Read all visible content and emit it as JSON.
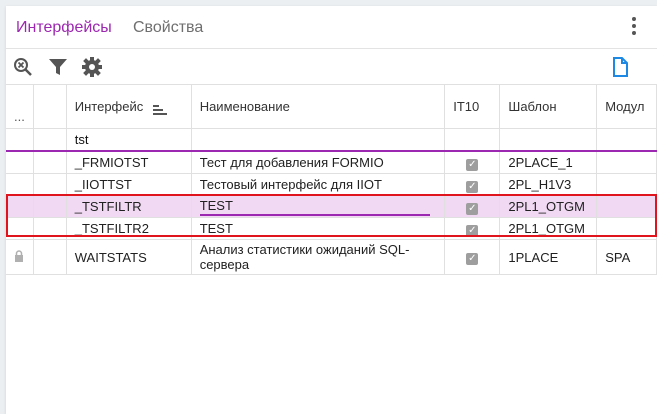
{
  "tabs": [
    {
      "label": "Интерфейсы",
      "active": true
    },
    {
      "label": "Свойства",
      "active": false
    }
  ],
  "toolbar": {
    "icons": [
      "clear-filter-icon",
      "filter-icon",
      "gear-icon",
      "document-icon"
    ]
  },
  "table": {
    "headers": {
      "dots": "...",
      "interface": "Интерфейс",
      "name": "Наименование",
      "it10": "IT10",
      "template": "Шаблон",
      "module": "Модул"
    },
    "filter": {
      "interface": "tst"
    },
    "rows": [
      {
        "interface": "_FRMIOTST",
        "name": "Тест для добавления FORMIO",
        "it10": true,
        "template": "2PLACE_1",
        "module": ""
      },
      {
        "interface": "_IIOTTST",
        "name": "Тестовый интерфейс для IIOT",
        "it10": true,
        "template": "2PL_H1V3",
        "module": ""
      },
      {
        "interface": "_TSTFILTR",
        "name": "TEST",
        "it10": true,
        "template": "2PL1_OTGM",
        "module": ""
      },
      {
        "interface": "_TSTFILTR2",
        "name": "TEST",
        "it10": true,
        "template": "2PL1_OTGM",
        "module": ""
      },
      {
        "interface": "WAITSTATS",
        "name": "Анализ статистики ожиданий SQL-сервера",
        "it10": true,
        "template": "1PLACE",
        "module": "SPA",
        "locked": true
      }
    ]
  },
  "colors": {
    "accent": "#9c27b0",
    "selected_row": "#f1d9f4",
    "highlight_box": "#e0141c",
    "doc_icon": "#1e88e5"
  }
}
